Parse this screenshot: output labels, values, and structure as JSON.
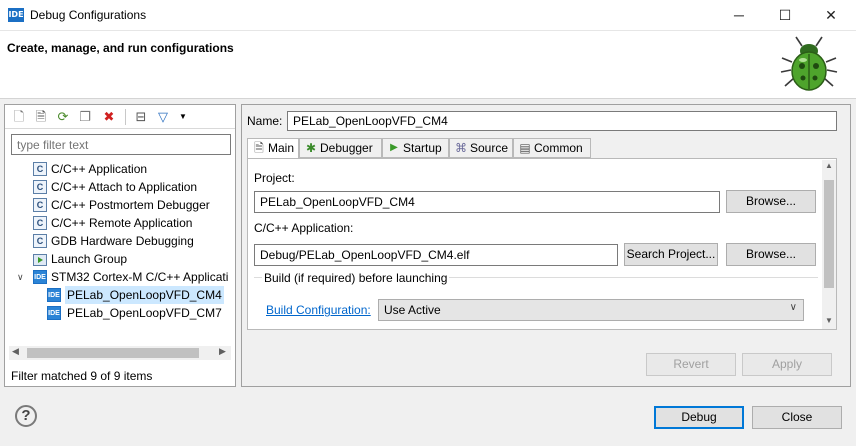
{
  "window": {
    "title": "Debug Configurations",
    "app_icon": "IDE",
    "minimize": "─",
    "maximize": "☐",
    "close": "✕"
  },
  "header": {
    "title": "Create, manage, and run configurations"
  },
  "toolbar": {
    "icons": [
      "new-config-icon",
      "new-prototype-icon",
      "export-icon",
      "duplicate-icon",
      "delete-icon",
      "collapse-all-icon",
      "filter-icon",
      "dropdown-icon"
    ]
  },
  "filter": {
    "placeholder": "type filter text"
  },
  "tree": {
    "items": [
      {
        "label": "C/C++ Application",
        "icon": "C"
      },
      {
        "label": "C/C++ Attach to Application",
        "icon": "C"
      },
      {
        "label": "C/C++ Postmortem Debugger",
        "icon": "C"
      },
      {
        "label": "C/C++ Remote Application",
        "icon": "C"
      },
      {
        "label": "GDB Hardware Debugging",
        "icon": "C"
      },
      {
        "label": "Launch Group",
        "icon": "launch-group-icon"
      },
      {
        "label": "STM32 Cortex-M C/C++ Applicati",
        "icon": "IDE",
        "expanded": true
      },
      {
        "label": "PELab_OpenLoopVFD_CM4",
        "icon": "IDE",
        "selected": true
      },
      {
        "label": "PELab_OpenLoopVFD_CM7",
        "icon": "IDE"
      }
    ],
    "status": "Filter matched 9 of 9 items"
  },
  "config": {
    "name_label": "Name:",
    "name_value": "PELab_OpenLoopVFD_CM4",
    "tabs": [
      "Main",
      "Debugger",
      "Startup",
      "Source",
      "Common"
    ],
    "active_tab": "Main",
    "project_label": "Project:",
    "project_value": "PELab_OpenLoopVFD_CM4",
    "browse_label": "Browse...",
    "app_label": "C/C++ Application:",
    "app_value": "Debug/PELab_OpenLoopVFD_CM4.elf",
    "search_project_label": "Search Project...",
    "build_group_label": "Build (if required) before launching",
    "build_config_link": "Build Configuration:",
    "build_config_value": "Use Active"
  },
  "actions": {
    "revert": "Revert",
    "apply": "Apply",
    "debug": "Debug",
    "close": "Close",
    "help": "?"
  }
}
